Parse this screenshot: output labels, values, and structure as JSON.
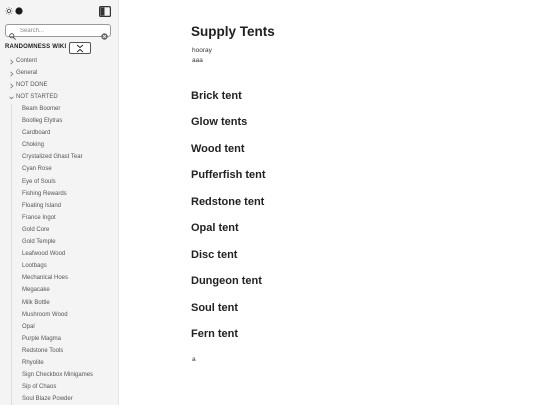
{
  "sidebar": {
    "search_placeholder": "Search...",
    "vault_name": "RANDOMNESS WIKI",
    "folders": [
      {
        "label": "Content",
        "expanded": false
      },
      {
        "label": "General",
        "expanded": false
      },
      {
        "label": "NOT DONE",
        "expanded": false
      },
      {
        "label": "NOT STARTED",
        "expanded": true
      }
    ],
    "files": [
      "Beam Boomer",
      "Bootleg Elytras",
      "Cardboard",
      "Choking",
      "Crystalized Ghast Tear",
      "Cyan Rose",
      "Eye of Souls",
      "Fishing Rewards",
      "Floating Island",
      "France Ingot",
      "Gold Core",
      "Gold Temple",
      "Leafwood Wood",
      "Lootbags",
      "Mechanical Hoes",
      "Megacake",
      "Milk Bottle",
      "Mushroom Wood",
      "Opal",
      "Purple Magma",
      "Redstone Tools",
      "Rhyolite",
      "Sign Checkbox Minigames",
      "Sip of Chaos",
      "Soul Blaze Powder"
    ]
  },
  "main": {
    "title": "Supply Tents",
    "intro_lines": [
      "hooray",
      "aaa"
    ],
    "headings": [
      "Brick tent",
      "Glow tents",
      "Wood tent",
      "Pufferfish tent",
      "Redstone tent",
      "Opal tent",
      "Disc tent",
      "Dungeon tent",
      "Soul tent",
      "Fern tent"
    ],
    "footer_text": "a"
  }
}
